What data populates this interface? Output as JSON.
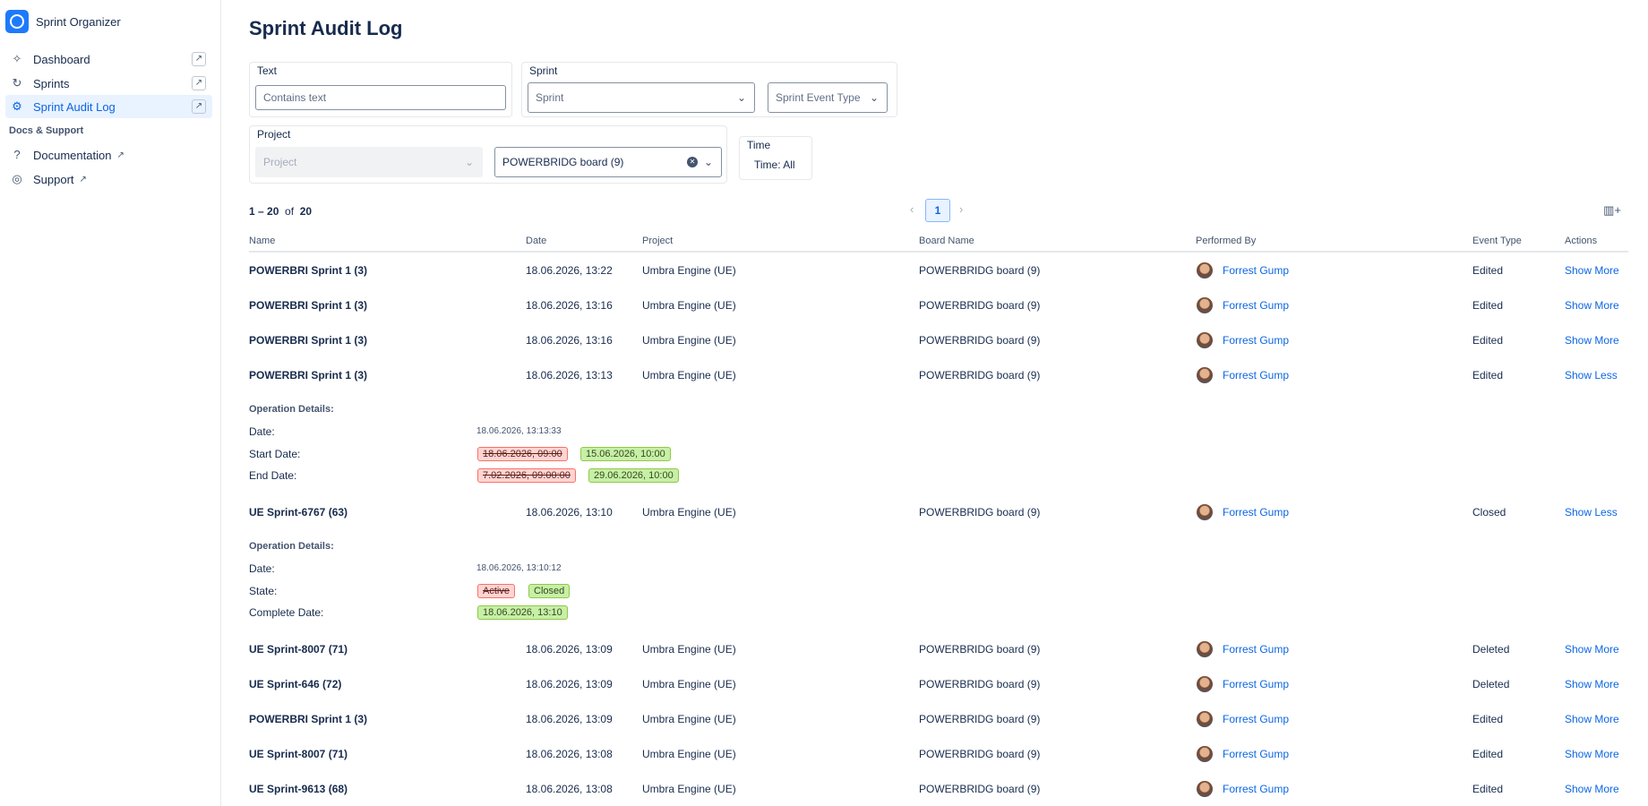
{
  "app": {
    "name": "Sprint Organizer"
  },
  "sidebar": {
    "items": [
      {
        "label": "Dashboard",
        "icon": "sparkle-icon"
      },
      {
        "label": "Sprints",
        "icon": "sprint-icon"
      },
      {
        "label": "Sprint Audit Log",
        "icon": "gear-icon",
        "active": true
      }
    ],
    "section_label": "Docs & Support",
    "docs": [
      {
        "label": "Documentation",
        "icon": "question-icon"
      },
      {
        "label": "Support",
        "icon": "support-icon"
      }
    ]
  },
  "page": {
    "title": "Sprint Audit Log"
  },
  "filters": {
    "text": {
      "legend": "Text",
      "placeholder": "Contains text"
    },
    "sprint": {
      "legend": "Sprint",
      "sprint_placeholder": "Sprint",
      "event_type_placeholder": "Sprint Event Type"
    },
    "project": {
      "legend": "Project",
      "project_placeholder": "Project",
      "board_value": "POWERBRIDG board (9)"
    },
    "time": {
      "legend": "Time",
      "value": "Time:  All"
    }
  },
  "pagination": {
    "range": "1 – 20",
    "of": "of",
    "total": "20",
    "current_page": "1"
  },
  "table": {
    "headers": {
      "name": "Name",
      "date": "Date",
      "project": "Project",
      "board": "Board Name",
      "performed_by": "Performed By",
      "event_type": "Event Type",
      "actions": "Actions"
    },
    "rows": [
      {
        "name": "POWERBRI Sprint 1 (3)",
        "date": "18.06.2026, 13:22",
        "project": "Umbra Engine (UE)",
        "board": "POWERBRIDG board (9)",
        "user": "Forrest Gump",
        "event": "Edited",
        "action": "Show More"
      },
      {
        "name": "POWERBRI Sprint 1 (3)",
        "date": "18.06.2026, 13:16",
        "project": "Umbra Engine (UE)",
        "board": "POWERBRIDG board (9)",
        "user": "Forrest Gump",
        "event": "Edited",
        "action": "Show More"
      },
      {
        "name": "POWERBRI Sprint 1 (3)",
        "date": "18.06.2026, 13:16",
        "project": "Umbra Engine (UE)",
        "board": "POWERBRIDG board (9)",
        "user": "Forrest Gump",
        "event": "Edited",
        "action": "Show More"
      },
      {
        "name": "POWERBRI Sprint 1 (3)",
        "date": "18.06.2026, 13:13",
        "project": "Umbra Engine (UE)",
        "board": "POWERBRIDG board (9)",
        "user": "Forrest Gump",
        "event": "Edited",
        "action": "Show Less"
      },
      {
        "name": "UE Sprint-6767 (63)",
        "date": "18.06.2026, 13:10",
        "project": "Umbra Engine (UE)",
        "board": "POWERBRIDG board (9)",
        "user": "Forrest Gump",
        "event": "Closed",
        "action": "Show Less"
      },
      {
        "name": "UE Sprint-8007 (71)",
        "date": "18.06.2026, 13:09",
        "project": "Umbra Engine (UE)",
        "board": "POWERBRIDG board (9)",
        "user": "Forrest Gump",
        "event": "Deleted",
        "action": "Show More"
      },
      {
        "name": "UE Sprint-646 (72)",
        "date": "18.06.2026, 13:09",
        "project": "Umbra Engine (UE)",
        "board": "POWERBRIDG board (9)",
        "user": "Forrest Gump",
        "event": "Deleted",
        "action": "Show More"
      },
      {
        "name": "POWERBRI Sprint 1 (3)",
        "date": "18.06.2026, 13:09",
        "project": "Umbra Engine (UE)",
        "board": "POWERBRIDG board (9)",
        "user": "Forrest Gump",
        "event": "Edited",
        "action": "Show More"
      },
      {
        "name": "UE Sprint-8007 (71)",
        "date": "18.06.2026, 13:08",
        "project": "Umbra Engine (UE)",
        "board": "POWERBRIDG board (9)",
        "user": "Forrest Gump",
        "event": "Edited",
        "action": "Show More"
      },
      {
        "name": "UE Sprint-9613 (68)",
        "date": "18.06.2026, 13:08",
        "project": "Umbra Engine (UE)",
        "board": "POWERBRIDG board (9)",
        "user": "Forrest Gump",
        "event": "Edited",
        "action": "Show More"
      }
    ],
    "details": [
      {
        "title": "Operation Details:",
        "date_label": "Date:",
        "date_value": "18.06.2026, 13:13:33",
        "lines": [
          {
            "label": "Start Date:",
            "old": "18.06.2026, 09:00",
            "new": "15.06.2026, 10:00"
          },
          {
            "label": "End Date:",
            "old": "7.02.2026, 09:00:00",
            "new": "29.06.2026, 10:00"
          }
        ]
      },
      {
        "title": "Operation Details:",
        "date_label": "Date:",
        "date_value": "18.06.2026, 13:10:12",
        "lines": [
          {
            "label": "State:",
            "old": "Active",
            "new": "Closed"
          },
          {
            "label": "Complete Date:",
            "new": "18.06.2026, 13:10"
          }
        ]
      }
    ]
  },
  "colors": {
    "accent": "#0c66e4",
    "old_chip": "#ffd5d2",
    "new_chip": "#c6f0a6"
  }
}
